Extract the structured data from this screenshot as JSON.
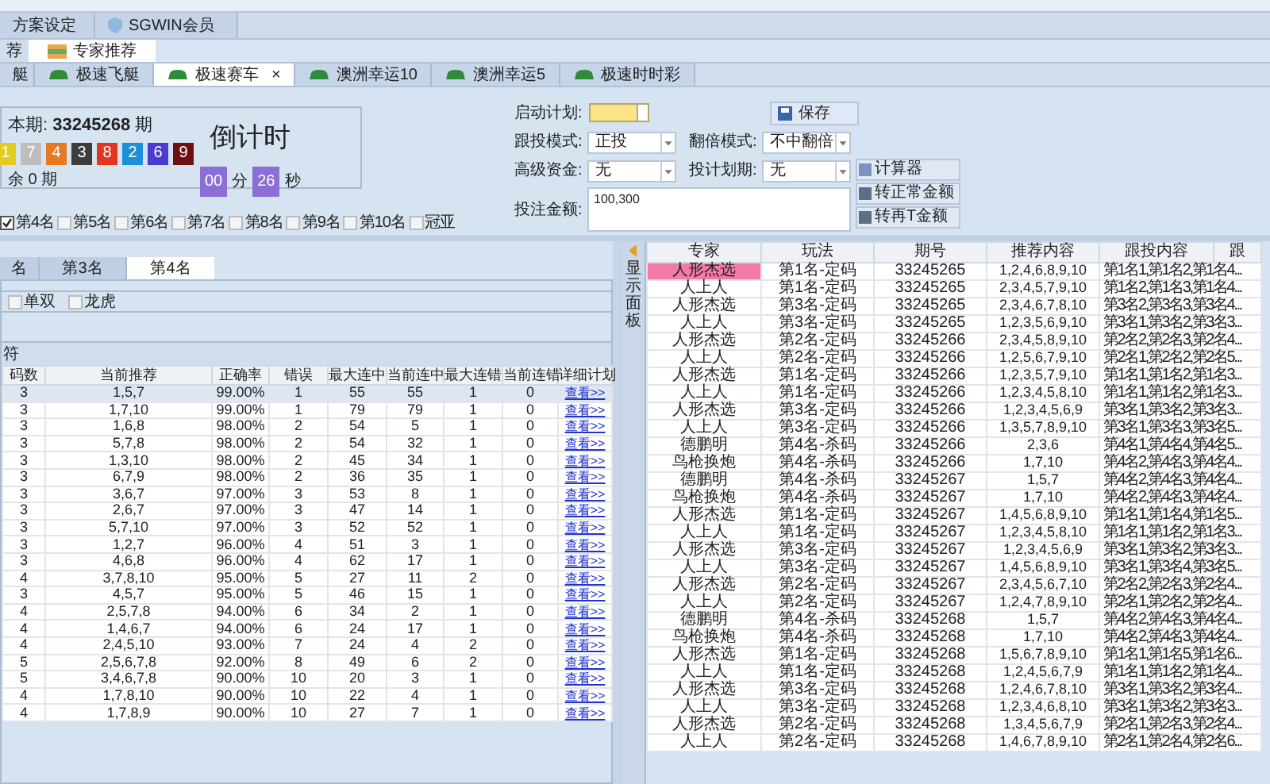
{
  "top_tabs": [
    {
      "label": "方案设定",
      "selected": false,
      "icon": false
    },
    {
      "label": "SGWIN会员",
      "selected": false,
      "icon": true
    }
  ],
  "sub_tabs": [
    {
      "label": "荐",
      "selected": false
    },
    {
      "label": "专家推荐",
      "selected": true
    }
  ],
  "game_tabs": [
    {
      "label": "艇",
      "selected": false
    },
    {
      "label": "极速飞艇",
      "selected": false
    },
    {
      "label": "极速赛车",
      "selected": true,
      "close": "×"
    },
    {
      "label": "澳洲幸运10",
      "selected": false
    },
    {
      "label": "澳洲幸运5",
      "selected": false
    },
    {
      "label": "极速时时彩",
      "selected": false
    }
  ],
  "draw": {
    "label": "本期:",
    "issue": "33245268",
    "unit": "期",
    "remaining": "余 0 期",
    "balls": [
      {
        "number": "1",
        "color": "#e3cc1c"
      },
      {
        "number": "7",
        "color": "#bdbdbd"
      },
      {
        "number": "4",
        "color": "#e67a22"
      },
      {
        "number": "3",
        "color": "#3d3d3d"
      },
      {
        "number": "8",
        "color": "#e2361f"
      },
      {
        "number": "2",
        "color": "#1b8fd9"
      },
      {
        "number": "6",
        "color": "#4b3bd2"
      },
      {
        "number": "9",
        "color": "#6e1010"
      }
    ]
  },
  "countdown": {
    "title": "倒计时",
    "minutes": "00",
    "minutes_unit": "分",
    "seconds": "26",
    "seconds_unit": "秒"
  },
  "positions": [
    {
      "label": "第4名",
      "checked": true
    },
    {
      "label": "第5名",
      "checked": false
    },
    {
      "label": "第6名",
      "checked": false
    },
    {
      "label": "第7名",
      "checked": false
    },
    {
      "label": "第8名",
      "checked": false
    },
    {
      "label": "第9名",
      "checked": false
    },
    {
      "label": "第10名",
      "checked": false
    },
    {
      "label": "冠亚",
      "checked": false
    }
  ],
  "form": {
    "start_label": "启动计划:",
    "start_on": true,
    "save": "保存",
    "follow_label": "跟投模式:",
    "follow_value": "正投",
    "double_label": "翻倍模式:",
    "double_value": "不中翻倍",
    "fund_label": "高级资金:",
    "fund_value": "无",
    "plan_label": "投计划期:",
    "plan_value": "无",
    "amount_label": "投注金额:",
    "amount_value": "100,300",
    "buttons": [
      "计算器",
      "转正常金额",
      "转再T金额"
    ]
  },
  "rank_tabs": [
    {
      "label": "名",
      "selected": false
    },
    {
      "label": "第3名",
      "selected": false
    },
    {
      "label": "第4名",
      "selected": true
    }
  ],
  "filters": [
    {
      "label": "单双",
      "checked": false
    },
    {
      "label": "龙虎",
      "checked": false
    }
  ],
  "group_title": "符",
  "left_table": {
    "columns": [
      "码数",
      "当前推荐",
      "正确率",
      "错误",
      "最大连中",
      "当前连中",
      "最大连错",
      "当前连错",
      "详细计划"
    ],
    "rows": [
      {
        "cells": [
          "3",
          "1,5,7",
          "99.00%",
          "1",
          "55",
          "55",
          "1",
          "0",
          "查看>>"
        ],
        "selected": true
      },
      {
        "cells": [
          "3",
          "1,7,10",
          "99.00%",
          "1",
          "79",
          "79",
          "1",
          "0",
          "查看>>"
        ],
        "selected": false
      },
      {
        "cells": [
          "3",
          "1,6,8",
          "98.00%",
          "2",
          "54",
          "5",
          "1",
          "0",
          "查看>>"
        ],
        "selected": false
      },
      {
        "cells": [
          "3",
          "5,7,8",
          "98.00%",
          "2",
          "54",
          "32",
          "1",
          "0",
          "查看>>"
        ],
        "selected": false
      },
      {
        "cells": [
          "3",
          "1,3,10",
          "98.00%",
          "2",
          "45",
          "34",
          "1",
          "0",
          "查看>>"
        ],
        "selected": false
      },
      {
        "cells": [
          "3",
          "6,7,9",
          "98.00%",
          "2",
          "36",
          "35",
          "1",
          "0",
          "查看>>"
        ],
        "selected": false
      },
      {
        "cells": [
          "3",
          "3,6,7",
          "97.00%",
          "3",
          "53",
          "8",
          "1",
          "0",
          "查看>>"
        ],
        "selected": false
      },
      {
        "cells": [
          "3",
          "2,6,7",
          "97.00%",
          "3",
          "47",
          "14",
          "1",
          "0",
          "查看>>"
        ],
        "selected": false
      },
      {
        "cells": [
          "3",
          "5,7,10",
          "97.00%",
          "3",
          "52",
          "52",
          "1",
          "0",
          "查看>>"
        ],
        "selected": false
      },
      {
        "cells": [
          "3",
          "1,2,7",
          "96.00%",
          "4",
          "51",
          "3",
          "1",
          "0",
          "查看>>"
        ],
        "selected": false
      },
      {
        "cells": [
          "3",
          "4,6,8",
          "96.00%",
          "4",
          "62",
          "17",
          "1",
          "0",
          "查看>>"
        ],
        "selected": false
      },
      {
        "cells": [
          "4",
          "3,7,8,10",
          "95.00%",
          "5",
          "27",
          "11",
          "2",
          "0",
          "查看>>"
        ],
        "selected": false
      },
      {
        "cells": [
          "3",
          "4,5,7",
          "95.00%",
          "5",
          "46",
          "15",
          "1",
          "0",
          "查看>>"
        ],
        "selected": false
      },
      {
        "cells": [
          "4",
          "2,5,7,8",
          "94.00%",
          "6",
          "34",
          "2",
          "1",
          "0",
          "查看>>"
        ],
        "selected": false
      },
      {
        "cells": [
          "4",
          "1,4,6,7",
          "94.00%",
          "6",
          "24",
          "17",
          "1",
          "0",
          "查看>>"
        ],
        "selected": false
      },
      {
        "cells": [
          "4",
          "2,4,5,10",
          "93.00%",
          "7",
          "24",
          "4",
          "2",
          "0",
          "查看>>"
        ],
        "selected": false
      },
      {
        "cells": [
          "5",
          "2,5,6,7,8",
          "92.00%",
          "8",
          "49",
          "6",
          "2",
          "0",
          "查看>>"
        ],
        "selected": false
      },
      {
        "cells": [
          "5",
          "3,4,6,7,8",
          "90.00%",
          "10",
          "20",
          "3",
          "1",
          "0",
          "查看>>"
        ],
        "selected": false
      },
      {
        "cells": [
          "4",
          "1,7,8,10",
          "90.00%",
          "10",
          "22",
          "4",
          "1",
          "0",
          "查看>>"
        ],
        "selected": false
      },
      {
        "cells": [
          "4",
          "1,7,8,9",
          "90.00%",
          "10",
          "27",
          "7",
          "1",
          "0",
          "查看>>"
        ],
        "selected": false
      }
    ]
  },
  "side_strip": "显示面板",
  "right_table": {
    "columns": [
      "专家",
      "玩法",
      "期号",
      "推荐内容",
      "跟投内容",
      "跟"
    ],
    "rows": [
      {
        "cells": [
          "人形杰选",
          "第1名-定码",
          "33245265",
          "1,2,4,6,8,9,10",
          "第1名1,第1名2,第1名4..."
        ],
        "selected": true
      },
      {
        "cells": [
          "人上人",
          "第1名-定码",
          "33245265",
          "2,3,4,5,7,9,10",
          "第1名2,第1名3,第1名4..."
        ],
        "selected": false
      },
      {
        "cells": [
          "人形杰选",
          "第3名-定码",
          "33245265",
          "2,3,4,6,7,8,10",
          "第3名2,第3名3,第3名4..."
        ],
        "selected": false
      },
      {
        "cells": [
          "人上人",
          "第3名-定码",
          "33245265",
          "1,2,3,5,6,9,10",
          "第3名1,第3名2,第3名3..."
        ],
        "selected": false
      },
      {
        "cells": [
          "人形杰选",
          "第2名-定码",
          "33245266",
          "2,3,4,5,8,9,10",
          "第2名2,第2名3,第2名4..."
        ],
        "selected": false
      },
      {
        "cells": [
          "人上人",
          "第2名-定码",
          "33245266",
          "1,2,5,6,7,9,10",
          "第2名1,第2名2,第2名5..."
        ],
        "selected": false
      },
      {
        "cells": [
          "人形杰选",
          "第1名-定码",
          "33245266",
          "1,2,3,5,7,9,10",
          "第1名1,第1名2,第1名3..."
        ],
        "selected": false
      },
      {
        "cells": [
          "人上人",
          "第1名-定码",
          "33245266",
          "1,2,3,4,5,8,10",
          "第1名1,第1名2,第1名3..."
        ],
        "selected": false
      },
      {
        "cells": [
          "人形杰选",
          "第3名-定码",
          "33245266",
          "1,2,3,4,5,6,9",
          "第3名1,第3名2,第3名3..."
        ],
        "selected": false
      },
      {
        "cells": [
          "人上人",
          "第3名-定码",
          "33245266",
          "1,3,5,7,8,9,10",
          "第3名1,第3名3,第3名5..."
        ],
        "selected": false
      },
      {
        "cells": [
          "德鹏明",
          "第4名-杀码",
          "33245266",
          "2,3,6",
          "第4名1,第4名4,第4名5..."
        ],
        "selected": false
      },
      {
        "cells": [
          "鸟枪换炮",
          "第4名-杀码",
          "33245266",
          "1,7,10",
          "第4名2,第4名3,第4名4..."
        ],
        "selected": false
      },
      {
        "cells": [
          "德鹏明",
          "第4名-杀码",
          "33245267",
          "1,5,7",
          "第4名2,第4名3,第4名4..."
        ],
        "selected": false
      },
      {
        "cells": [
          "鸟枪换炮",
          "第4名-杀码",
          "33245267",
          "1,7,10",
          "第4名2,第4名3,第4名4..."
        ],
        "selected": false
      },
      {
        "cells": [
          "人形杰选",
          "第1名-定码",
          "33245267",
          "1,4,5,6,8,9,10",
          "第1名1,第1名4,第1名5..."
        ],
        "selected": false
      },
      {
        "cells": [
          "人上人",
          "第1名-定码",
          "33245267",
          "1,2,3,4,5,8,10",
          "第1名1,第1名2,第1名3..."
        ],
        "selected": false
      },
      {
        "cells": [
          "人形杰选",
          "第3名-定码",
          "33245267",
          "1,2,3,4,5,6,9",
          "第3名1,第3名2,第3名3..."
        ],
        "selected": false
      },
      {
        "cells": [
          "人上人",
          "第3名-定码",
          "33245267",
          "1,4,5,6,8,9,10",
          "第3名1,第3名4,第3名5..."
        ],
        "selected": false
      },
      {
        "cells": [
          "人形杰选",
          "第2名-定码",
          "33245267",
          "2,3,4,5,6,7,10",
          "第2名2,第2名3,第2名4..."
        ],
        "selected": false
      },
      {
        "cells": [
          "人上人",
          "第2名-定码",
          "33245267",
          "1,2,4,7,8,9,10",
          "第2名1,第2名2,第2名4..."
        ],
        "selected": false
      },
      {
        "cells": [
          "德鹏明",
          "第4名-杀码",
          "33245268",
          "1,5,7",
          "第4名2,第4名3,第4名4..."
        ],
        "selected": false
      },
      {
        "cells": [
          "鸟枪换炮",
          "第4名-杀码",
          "33245268",
          "1,7,10",
          "第4名2,第4名3,第4名4..."
        ],
        "selected": false
      },
      {
        "cells": [
          "人形杰选",
          "第1名-定码",
          "33245268",
          "1,5,6,7,8,9,10",
          "第1名1,第1名5,第1名6..."
        ],
        "selected": false
      },
      {
        "cells": [
          "人上人",
          "第1名-定码",
          "33245268",
          "1,2,4,5,6,7,9",
          "第1名1,第1名2,第1名4..."
        ],
        "selected": false
      },
      {
        "cells": [
          "人形杰选",
          "第3名-定码",
          "33245268",
          "1,2,4,6,7,8,10",
          "第3名1,第3名2,第3名4..."
        ],
        "selected": false
      },
      {
        "cells": [
          "人上人",
          "第3名-定码",
          "33245268",
          "1,2,3,4,6,8,10",
          "第3名1,第3名2,第3名3..."
        ],
        "selected": false
      },
      {
        "cells": [
          "人形杰选",
          "第2名-定码",
          "33245268",
          "1,3,4,5,6,7,9",
          "第2名1,第2名3,第2名4..."
        ],
        "selected": false
      },
      {
        "cells": [
          "人上人",
          "第2名-定码",
          "33245268",
          "1,4,6,7,8,9,10",
          "第2名1,第2名4,第2名6..."
        ],
        "selected": false
      }
    ]
  }
}
